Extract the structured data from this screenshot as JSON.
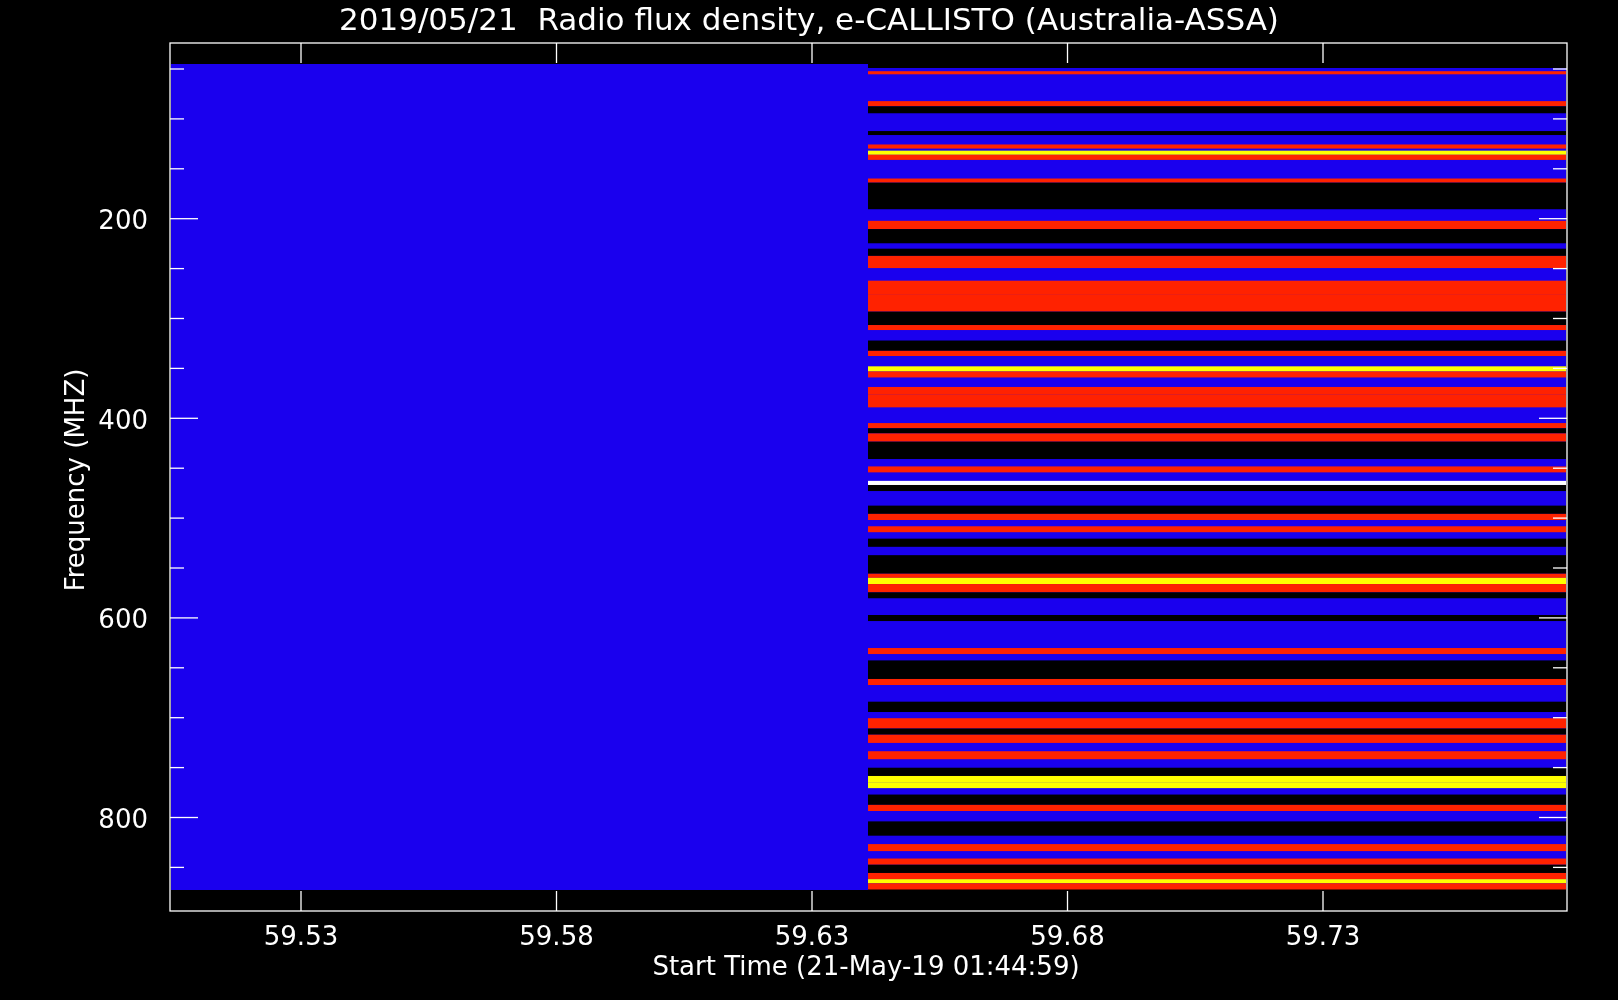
{
  "title": "2019/05/21  Radio flux density, e-CALLISTO (Australia-ASSA)",
  "ylabel": "Frequency (MHZ)",
  "yticks": [
    "200",
    "400",
    "600",
    "800"
  ],
  "xlabel": "Start Time (21-May-19 01:44:59)",
  "xticks": [
    "59.53",
    "59.58",
    "59.63",
    "59.68",
    "59.73"
  ]
}
